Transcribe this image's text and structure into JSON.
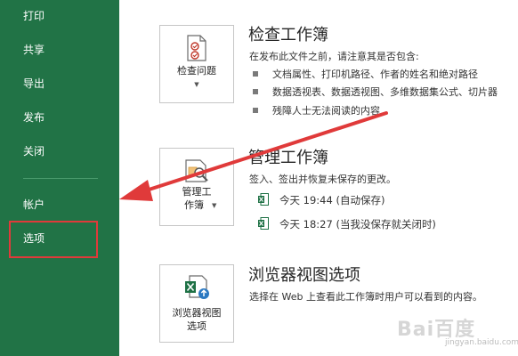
{
  "sidebar": {
    "items": [
      {
        "label": "打印"
      },
      {
        "label": "共享"
      },
      {
        "label": "导出"
      },
      {
        "label": "发布"
      },
      {
        "label": "关闭"
      },
      {
        "label": "帐户"
      },
      {
        "label": "选项"
      }
    ]
  },
  "sections": {
    "inspect": {
      "button_label": "检查问题",
      "title": "检查工作簿",
      "description": "在发布此文件之前，请注意其是否包含:",
      "bullets": [
        "文档属性、打印机路径、作者的姓名和绝对路径",
        "数据透视表、数据透视图、多维数据集公式、切片器",
        "残障人士无法阅读的内容"
      ]
    },
    "manage": {
      "button_label_1": "管理工",
      "button_label_2": "作簿",
      "title": "管理工作簿",
      "description": "签入、签出并恢复未保存的更改。",
      "versions": [
        "今天 19:44 (自动保存)",
        "今天 18:27 (当我没保存就关闭时)"
      ]
    },
    "browser": {
      "button_label_1": "浏览器视图",
      "button_label_2": "选项",
      "title": "浏览器视图选项",
      "description": "选择在 Web 上查看此工作簿时用户可以看到的内容。"
    }
  },
  "watermark": {
    "text": "Bai百度",
    "sub": "jingyan.baidu.com"
  },
  "colors": {
    "sidebar_bg": "#217346",
    "highlight": "#e03a3a",
    "arrow": "#e03a3a",
    "excel_green": "#1e7145"
  }
}
